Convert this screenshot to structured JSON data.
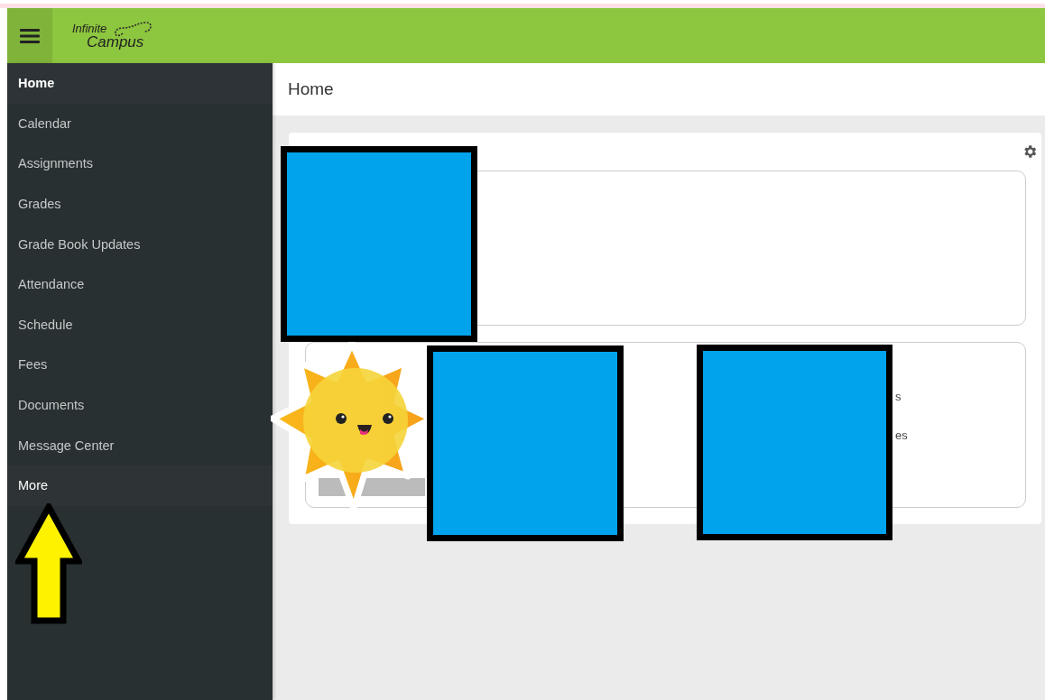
{
  "header": {
    "logo_line_1": "Infinite",
    "logo_line_2": "Campus"
  },
  "sidebar": {
    "items": [
      {
        "label": "Home",
        "selected": true,
        "hovered": false
      },
      {
        "label": "Calendar",
        "selected": false,
        "hovered": false
      },
      {
        "label": "Assignments",
        "selected": false,
        "hovered": false
      },
      {
        "label": "Grades",
        "selected": false,
        "hovered": false
      },
      {
        "label": "Grade Book Updates",
        "selected": false,
        "hovered": false
      },
      {
        "label": "Attendance",
        "selected": false,
        "hovered": false
      },
      {
        "label": "Schedule",
        "selected": false,
        "hovered": false
      },
      {
        "label": "Fees",
        "selected": false,
        "hovered": false
      },
      {
        "label": "Documents",
        "selected": false,
        "hovered": false
      },
      {
        "label": "Message Center",
        "selected": false,
        "hovered": false
      },
      {
        "label": "More",
        "selected": false,
        "hovered": true
      }
    ]
  },
  "page": {
    "title": "Home"
  },
  "card_2": {
    "lines": [
      "s",
      "es"
    ]
  }
}
